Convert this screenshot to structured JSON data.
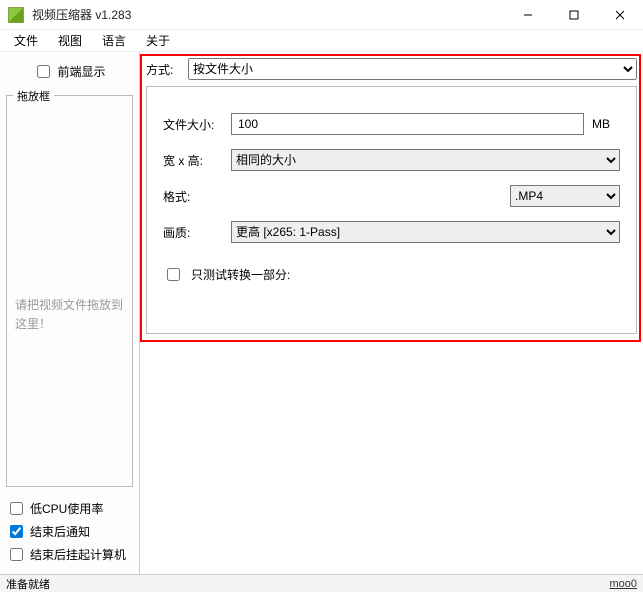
{
  "titlebar": {
    "title": "视频压缩器 v1.283"
  },
  "menu": {
    "file": "文件",
    "view": "视图",
    "lang": "语言",
    "about": "关于"
  },
  "sidebar": {
    "front_display": "前端显示",
    "dropzone_legend": "拖放框",
    "dropzone_hint": "请把视频文件拖放到这里！",
    "low_cpu": "低CPU使用率",
    "notify_done": "结束后通知",
    "suspend_done": "结束后挂起计算机"
  },
  "main": {
    "method_label": "方式:",
    "method_value": "按文件大小",
    "filesize_label": "文件大小:",
    "filesize_value": "100",
    "filesize_unit": "MB",
    "wh_label": "宽 x 高:",
    "wh_value": "相同的大小",
    "format_label": "格式:",
    "format_value": ".MP4",
    "quality_label": "画质:",
    "quality_value": "更高      [x265: 1-Pass]",
    "test_only": "只测试转换一部分:"
  },
  "status": {
    "ready": "准备就绪",
    "link": "moo0"
  }
}
